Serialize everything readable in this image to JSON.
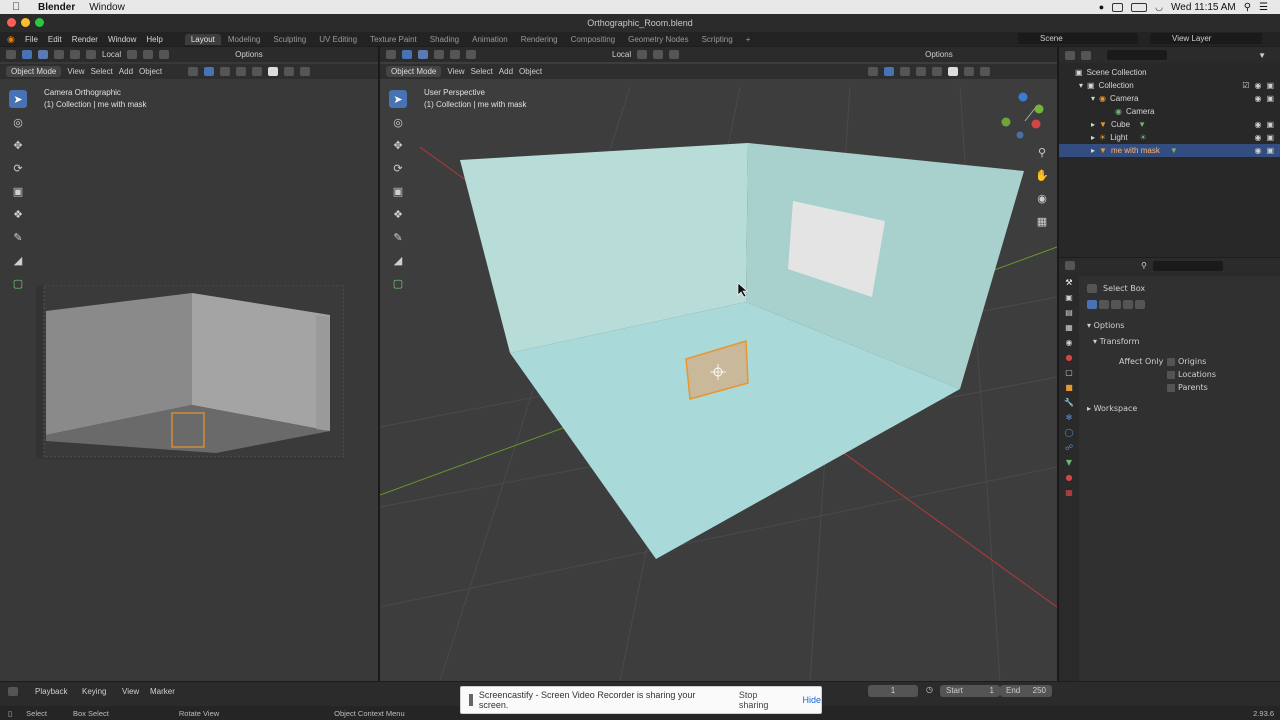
{
  "macos": {
    "app_name": "Blender",
    "menu": [
      "Window"
    ],
    "clock": "Wed 11:15 AM"
  },
  "window": {
    "title": "Orthographic_Room.blend"
  },
  "topbar": {
    "menus": [
      "File",
      "Edit",
      "Render",
      "Window",
      "Help"
    ],
    "workspaces": [
      "Layout",
      "Modeling",
      "Sculpting",
      "UV Editing",
      "Texture Paint",
      "Shading",
      "Animation",
      "Rendering",
      "Compositing",
      "Geometry Nodes",
      "Scripting"
    ],
    "active_workspace": "Layout",
    "scene": "Scene",
    "view_layer": "View Layer"
  },
  "left_view": {
    "mode": "Object Mode",
    "menus": [
      "View",
      "Select",
      "Add",
      "Object"
    ],
    "transform_orientation": "Local",
    "options": "Options",
    "title": "Camera Orthographic",
    "subtitle": "(1) Collection | me with mask"
  },
  "main_view": {
    "mode": "Object Mode",
    "menus": [
      "View",
      "Select",
      "Add",
      "Object"
    ],
    "transform_orientation": "Local",
    "options": "Options",
    "title": "User Perspective",
    "subtitle": "(1) Collection | me with mask"
  },
  "outliner": {
    "root": "Scene Collection",
    "items": [
      {
        "label": "Collection",
        "level": 1
      },
      {
        "label": "Camera",
        "level": 2
      },
      {
        "label": "Camera",
        "level": 3
      },
      {
        "label": "Cube",
        "level": 2
      },
      {
        "label": "Light",
        "level": 2
      },
      {
        "label": "me with mask",
        "level": 2
      }
    ]
  },
  "properties": {
    "tool": "Select Box",
    "options_label": "Options",
    "transform_label": "Transform",
    "affect_only": "Affect Only",
    "checks": [
      "Origins",
      "Locations",
      "Parents"
    ],
    "workspace_label": "Workspace"
  },
  "timeline": {
    "menus": [
      "Playback",
      "Keying",
      "View",
      "Marker"
    ],
    "current_frame": "1",
    "start_label": "Start",
    "start": "1",
    "end_label": "End",
    "end": "250"
  },
  "statusbar": {
    "items": [
      "Select",
      "Box Select",
      "Rotate View",
      "Object Context Menu"
    ],
    "version": "2.93.6"
  },
  "notification": {
    "text": "Screencastify - Screen Video Recorder is sharing your screen.",
    "stop": "Stop sharing",
    "hide": "Hide"
  },
  "colors": {
    "accent": "#4772b3",
    "selection": "#334d80",
    "room_wall": "#b8dcd8",
    "room_floor": "#a9dad9",
    "object_outline": "#e8962f"
  }
}
